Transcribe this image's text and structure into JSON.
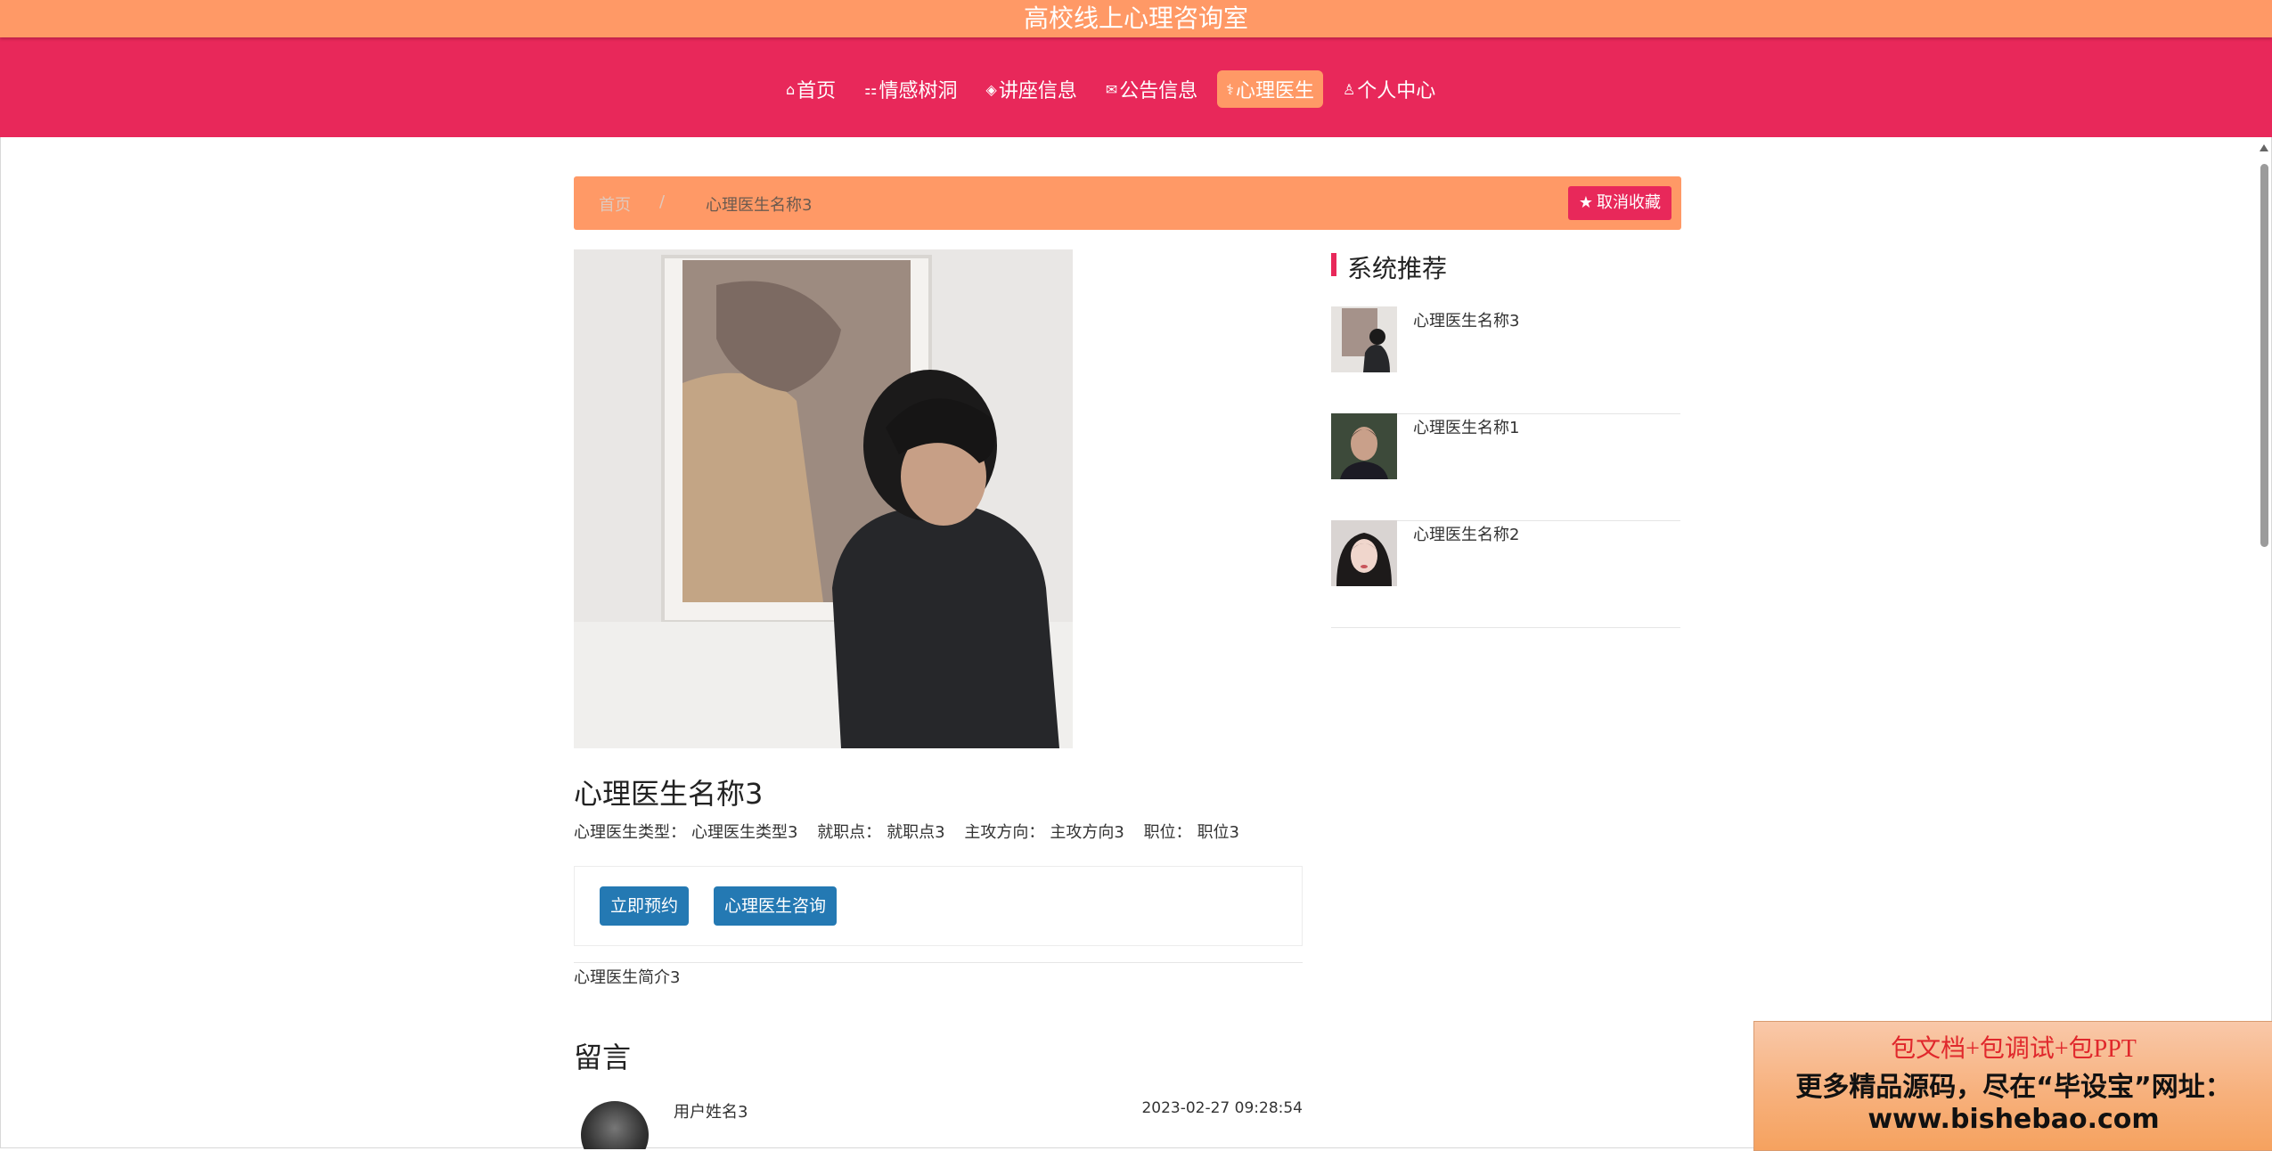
{
  "site": {
    "title": "高校线上心理咨询室"
  },
  "nav": {
    "items": [
      {
        "icon": "home-icon",
        "label": "首页"
      },
      {
        "icon": "grid-icon",
        "label": "情感树洞"
      },
      {
        "icon": "layers-icon",
        "label": "讲座信息"
      },
      {
        "icon": "mail-icon",
        "label": "公告信息"
      },
      {
        "icon": "doctor-icon",
        "label": "心理医生"
      },
      {
        "icon": "user-icon",
        "label": "个人中心"
      }
    ],
    "active": "心理医生"
  },
  "breadcrumb": {
    "home": "首页",
    "separator": "/",
    "current": "心理医生名称3"
  },
  "favorite": {
    "label": "取消收藏",
    "icon": "star-icon"
  },
  "doctor": {
    "name": "心理医生名称3",
    "type_label": "心理医生类型：",
    "type_value": "心理医生类型3",
    "location_label": "就职点：",
    "location_value": "就职点3",
    "direction_label": "主攻方向：",
    "direction_value": "主攻方向3",
    "position_label": "职位：",
    "position_value": "职位3",
    "intro": "心理医生简介3"
  },
  "actions": {
    "book": "立即预约",
    "consult": "心理医生咨询"
  },
  "messages": {
    "title": "留言",
    "items": [
      {
        "user": "用户姓名3",
        "time": "2023-02-27 09:28:54"
      }
    ]
  },
  "recommend": {
    "title": "系统推荐",
    "items": [
      {
        "name": "心理医生名称3"
      },
      {
        "name": "心理医生名称1"
      },
      {
        "name": "心理医生名称2"
      }
    ]
  },
  "promo": {
    "line1": "包文档+包调试+包PPT",
    "line2": "更多精品源码，尽在“毕设宝”网址：",
    "line3": "www.bishebao.com"
  },
  "colors": {
    "orange": "#ff9966",
    "pink": "#e8285a",
    "blue": "#2479b3"
  }
}
